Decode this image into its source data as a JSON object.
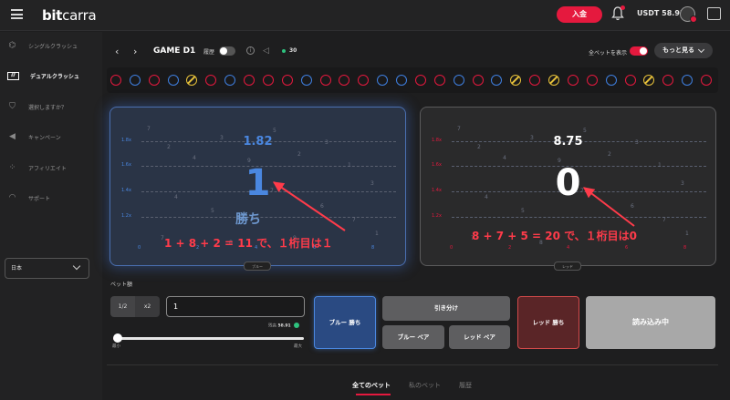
{
  "header": {
    "logo_bold": "bit",
    "logo_thin": "carra",
    "deposit_label": "入金",
    "balance": "USDT 58.91"
  },
  "sidebar": {
    "items": [
      {
        "label": "シングルクラッシュ",
        "icon": "rocket-icon"
      },
      {
        "label": "デュアルクラッシュ",
        "icon": "dual-chart-icon"
      },
      {
        "label": "選択しますか？",
        "icon": "shield-icon"
      },
      {
        "label": "キャンペーン",
        "icon": "megaphone-icon"
      },
      {
        "label": "アフィリエイト",
        "icon": "network-icon"
      },
      {
        "label": "サポート",
        "icon": "headset-icon"
      }
    ],
    "language": "日本"
  },
  "gamebar": {
    "title": "GAME D1",
    "history_label": "履歴",
    "online_count": "30",
    "show_all_bets_label": "全ベットを表示",
    "more_label": "もっと見る"
  },
  "history": [
    "red",
    "blue",
    "red",
    "blue",
    "tie",
    "red",
    "blue",
    "red",
    "red",
    "red",
    "blue",
    "red",
    "red",
    "red",
    "blue",
    "blue",
    "red",
    "red",
    "blue",
    "red",
    "blue",
    "tie",
    "red",
    "tie",
    "red",
    "red",
    "blue",
    "red",
    "tie",
    "red",
    "blue",
    "red"
  ],
  "blue_panel": {
    "multiplier": "1.82",
    "digit": "1",
    "win_text": "勝ち",
    "annotation": "1 + 8 + 2 = 11 で、１桁目は１",
    "y_ticks": [
      "1.8x",
      "1.6x",
      "1.4x",
      "1.2x"
    ],
    "x_ticks": [
      "0",
      "2",
      "4",
      "6",
      "8"
    ],
    "tab_label": "ブルー",
    "color": "#4a87e0"
  },
  "red_panel": {
    "multiplier": "8.75",
    "digit": "0",
    "annotation": "8 + 7 + 5 = 20 で、１桁目は0",
    "y_ticks": [
      "1.8x",
      "1.6x",
      "1.4x",
      "1.2x"
    ],
    "x_ticks": [
      "0",
      "2",
      "4",
      "6",
      "8"
    ],
    "tab_label": "レッド",
    "color": "#e5193e"
  },
  "bet": {
    "amount_label": "ベット額",
    "half_label": "1/2",
    "double_label": "x2",
    "amount_value": "1",
    "balance_label": "残高",
    "balance_value": "58.91",
    "slider_min": "最小",
    "slider_max": "最大",
    "slider_fraction": 0.02
  },
  "buttons": {
    "blue_win": "ブルー 勝ち",
    "tie": "引き分け",
    "blue_pair": "ブルー ペア",
    "red_pair": "レッド ペア",
    "red_win": "レッド 勝ち",
    "loading": "読み込み中"
  },
  "tabs": {
    "all_bets": "全てのベット",
    "my_bets": "私のベット",
    "history": "履歴"
  }
}
